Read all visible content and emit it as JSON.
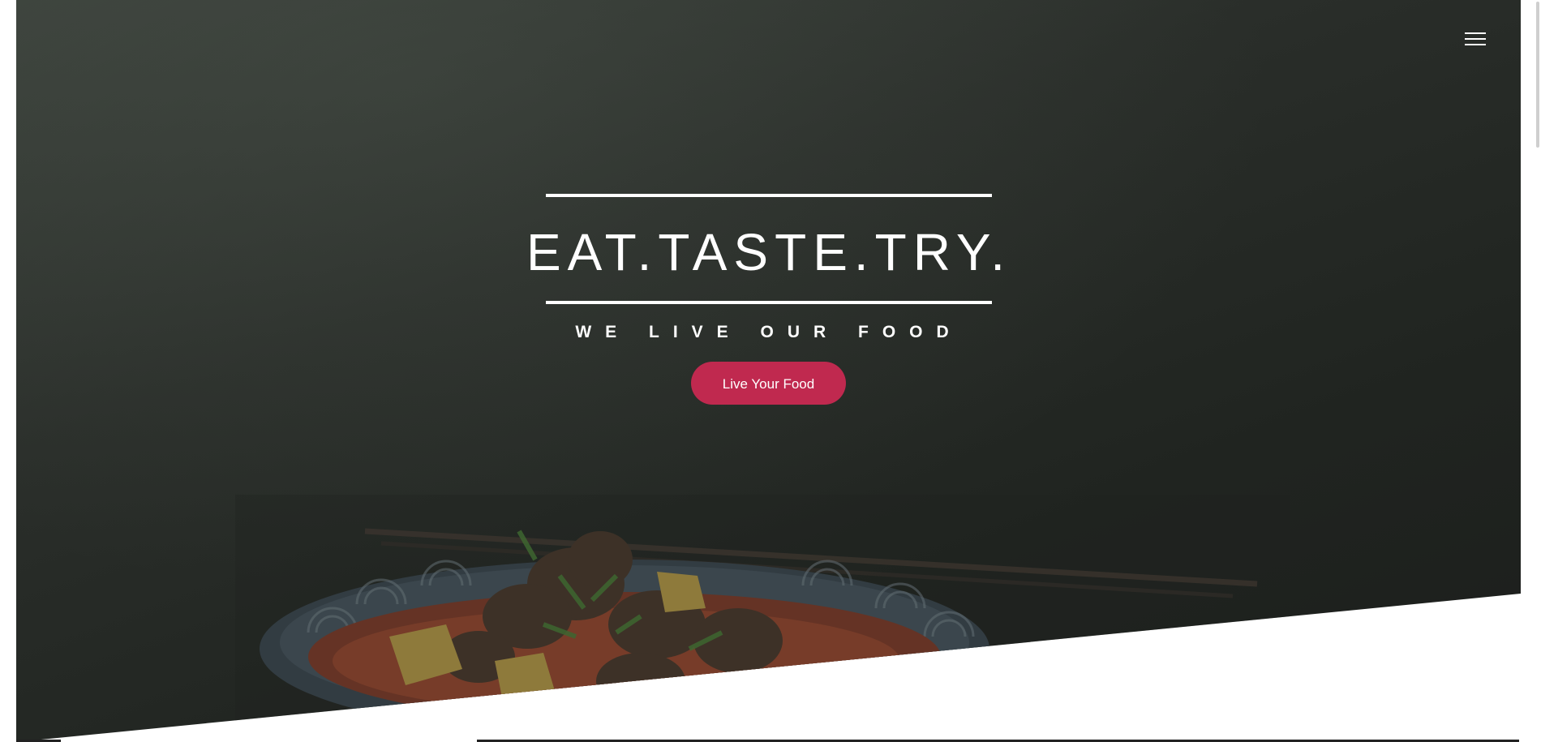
{
  "hero": {
    "title": "EAT.TASTE.TRY.",
    "subtitle": "WE LIVE OUR FOOD",
    "cta_label": "Live Your Food"
  },
  "nav": {
    "menu_icon": "hamburger-menu-icon"
  },
  "colors": {
    "accent": "#c0294f",
    "hero_overlay": "#262a26",
    "text": "#ffffff"
  }
}
